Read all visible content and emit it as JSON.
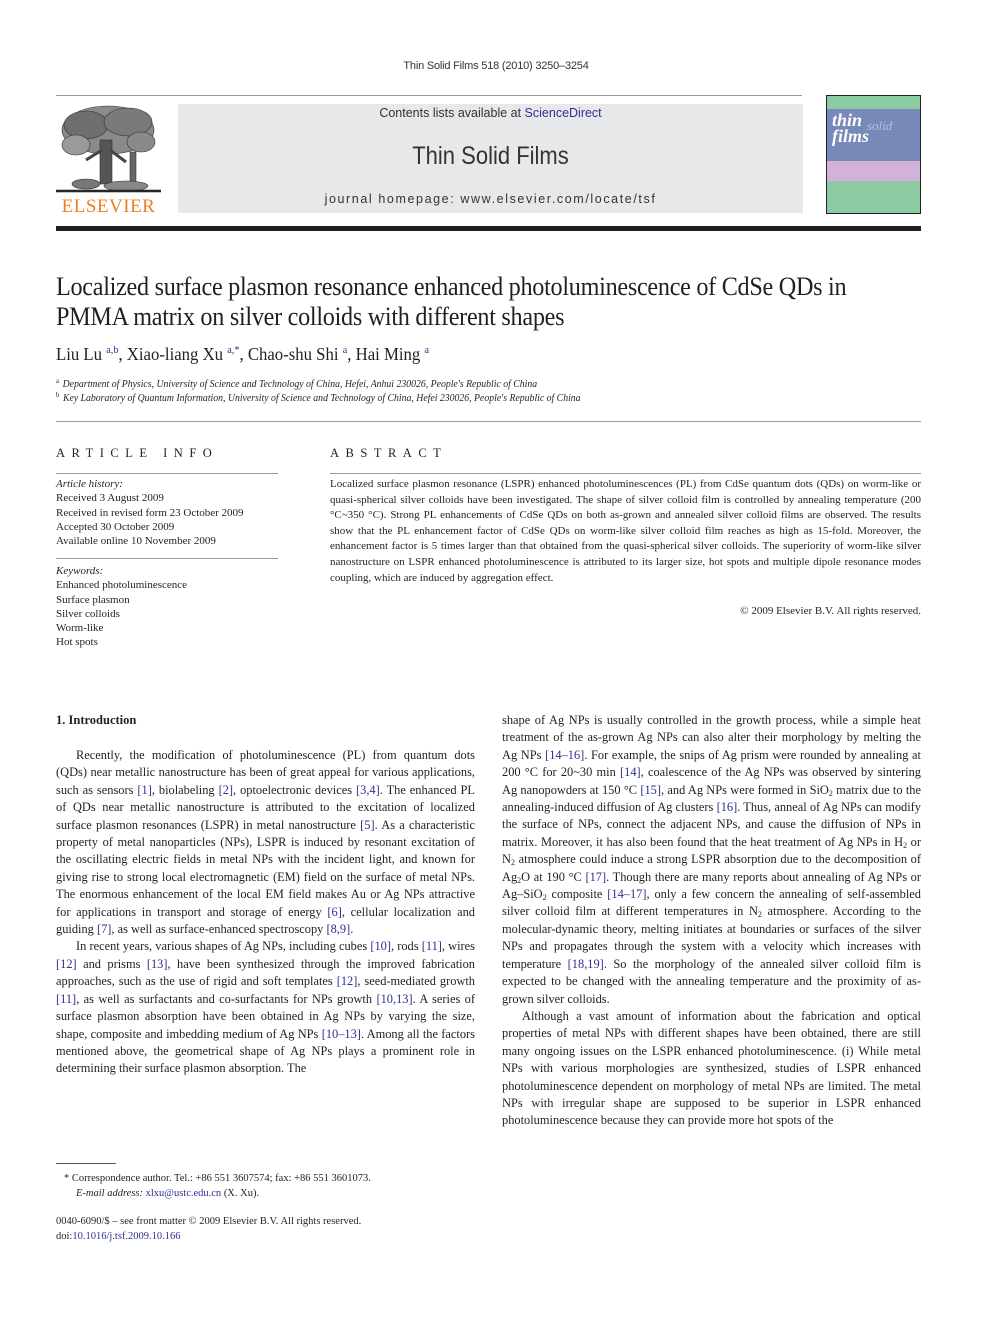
{
  "header": {
    "running_head": "Thin Solid Films 518 (2010) 3250–3254",
    "publisher_logo": "ELSEVIER",
    "contents_prefix": "Contents lists available at ",
    "contents_link": "ScienceDirect",
    "journal_title": "Thin Solid Films",
    "homepage": "journal homepage: www.elsevier.com/locate/tsf",
    "cover_word_1": "thin",
    "cover_word_2": "films",
    "cover_word_3": "solid"
  },
  "article": {
    "title": "Localized surface plasmon resonance enhanced photoluminescence of CdSe QDs in PMMA matrix on silver colloids with different shapes",
    "authors": [
      {
        "name": "Liu Lu",
        "sup": "a,b",
        "sep": ", "
      },
      {
        "name": "Xiao-liang Xu",
        "sup": "a,*",
        "sep": ", "
      },
      {
        "name": "Chao-shu Shi",
        "sup": "a",
        "sep": ", "
      },
      {
        "name": "Hai Ming",
        "sup": "a",
        "sep": ""
      }
    ],
    "affiliations": [
      {
        "mark": "a",
        "text": "Department of Physics, University of Science and Technology of China, Hefei, Anhui 230026, People's Republic of China"
      },
      {
        "mark": "b",
        "text": "Key Laboratory of Quantum Information, University of Science and Technology of China, Hefei 230026, People's Republic of China"
      }
    ]
  },
  "article_info": {
    "label": "ARTICLE INFO",
    "history_heading": "Article history:",
    "history": [
      "Received 3 August 2009",
      "Received in revised form 23 October 2009",
      "Accepted 30 October 2009",
      "Available online 10 November 2009"
    ],
    "keywords_heading": "Keywords:",
    "keywords": [
      "Enhanced photoluminescence",
      "Surface plasmon",
      "Silver colloids",
      "Worm-like",
      "Hot spots"
    ]
  },
  "abstract": {
    "label": "ABSTRACT",
    "text": "Localized surface plasmon resonance (LSPR) enhanced photoluminescences (PL) from CdSe quantum dots (QDs) on worm-like or quasi-spherical silver colloids have been investigated. The shape of silver colloid film is controlled by annealing temperature (200 °C~350 °C). Strong PL enhancements of CdSe QDs on both as-grown and annealed silver colloid films are observed. The results show that the PL enhancement factor of CdSe QDs on worm-like silver colloid film reaches as high as 15-fold. Moreover, the enhancement factor is 5 times larger than that obtained from the quasi-spherical silver colloids. The superiority of worm-like silver nanostructure on LSPR enhanced photoluminescence is attributed to its larger size, hot spots and multiple dipole resonance modes coupling, which are induced by aggregation effect.",
    "copyright": "© 2009 Elsevier B.V. All rights reserved."
  },
  "body": {
    "section_heading": "1. Introduction",
    "left_paragraphs": [
      [
        {
          "t": "Recently, the modification of photoluminescence (PL) from quantum dots (QDs) near metallic nanostructure has been of great appeal for various applications, such as sensors "
        },
        {
          "ref": "[1]"
        },
        {
          "t": ", biolabeling "
        },
        {
          "ref": "[2]"
        },
        {
          "t": ", optoelectronic devices "
        },
        {
          "ref": "[3,4]"
        },
        {
          "t": ". The enhanced PL of QDs near metallic nanostructure is attributed to the excitation of localized surface plasmon resonances (LSPR) in metal nanostructure "
        },
        {
          "ref": "[5]"
        },
        {
          "t": ". As a characteristic property of metal nanoparticles (NPs), LSPR is induced by resonant excitation of the oscillating electric fields in metal NPs with the incident light, and known for giving rise to strong local electromagnetic (EM) field on the surface of metal NPs. The enormous enhancement of the local EM field makes Au or Ag NPs attractive for applications in transport and storage of energy "
        },
        {
          "ref": "[6]"
        },
        {
          "t": ", cellular localization and guiding "
        },
        {
          "ref": "[7]"
        },
        {
          "t": ", as well as surface-enhanced spectroscopy "
        },
        {
          "ref": "[8,9]"
        },
        {
          "t": "."
        }
      ],
      [
        {
          "t": "In recent years, various shapes of Ag NPs, including cubes "
        },
        {
          "ref": "[10]"
        },
        {
          "t": ", rods "
        },
        {
          "ref": "[11]"
        },
        {
          "t": ", wires "
        },
        {
          "ref": "[12]"
        },
        {
          "t": " and prisms "
        },
        {
          "ref": "[13]"
        },
        {
          "t": ", have been synthesized through the improved fabrication approaches, such as the use of rigid and soft templates "
        },
        {
          "ref": "[12]"
        },
        {
          "t": ", seed-mediated growth "
        },
        {
          "ref": "[11]"
        },
        {
          "t": ", as well as surfactants and co-surfactants for NPs growth "
        },
        {
          "ref": "[10,13]"
        },
        {
          "t": ". A series of surface plasmon absorption have been obtained in Ag NPs by varying the size, shape, composite and imbedding medium of Ag NPs "
        },
        {
          "ref": "[10–13]"
        },
        {
          "t": ". Among all the factors mentioned above, the geometrical shape of Ag NPs plays a prominent role in determining their surface plasmon absorption. The"
        }
      ]
    ],
    "right_paragraphs": [
      [
        {
          "t": "shape of Ag NPs is usually controlled in the growth process, while a simple heat treatment of the as-grown Ag NPs can also alter their morphology by melting the Ag NPs "
        },
        {
          "ref": "[14–16]"
        },
        {
          "t": ". For example, the snips of Ag prism were rounded by annealing at 200 °C for 20~30 min "
        },
        {
          "ref": "[14]"
        },
        {
          "t": ", coalescence of the Ag NPs was observed by sintering Ag nanopowders at 150 °C "
        },
        {
          "ref": "[15]"
        },
        {
          "t": ", and Ag NPs were formed in SiO"
        },
        {
          "sub": "2"
        },
        {
          "t": " matrix due to the annealing-induced diffusion of Ag clusters "
        },
        {
          "ref": "[16]"
        },
        {
          "t": ". Thus, anneal of Ag NPs can modify the surface of NPs, connect the adjacent NPs, and cause the diffusion of NPs in matrix. Moreover, it has also been found that the heat treatment of Ag NPs in H"
        },
        {
          "sub": "2"
        },
        {
          "t": " or N"
        },
        {
          "sub": "2"
        },
        {
          "t": " atmosphere could induce a strong LSPR absorption due to the decomposition of Ag"
        },
        {
          "sub": "2"
        },
        {
          "t": "O at 190 °C "
        },
        {
          "ref": "[17]"
        },
        {
          "t": ". Though there are many reports about annealing of Ag NPs or Ag–SiO"
        },
        {
          "sub": "2"
        },
        {
          "t": " composite "
        },
        {
          "ref": "[14–17]"
        },
        {
          "t": ", only a few concern the annealing of self-assembled silver colloid film at different temperatures in N"
        },
        {
          "sub": "2"
        },
        {
          "t": " atmosphere. According to the molecular-dynamic theory, melting initiates at boundaries or surfaces of the silver NPs and propagates through the system with a velocity which increases with temperature "
        },
        {
          "ref": "[18,19]"
        },
        {
          "t": ". So the morphology of the annealed silver colloid film is expected to be changed with the annealing temperature and the proximity of as-grown silver colloids."
        }
      ],
      [
        {
          "t": "Although a vast amount of information about the fabrication and optical properties of metal NPs with different shapes have been obtained, there are still many ongoing issues on the LSPR enhanced photoluminescence. (i) While metal NPs with various morphologies are synthesized, studies of LSPR enhanced photoluminescence dependent on morphology of metal NPs are limited. The metal NPs with irregular shape are supposed to be superior in LSPR enhanced photoluminescence because they can provide more hot spots of the"
        }
      ]
    ]
  },
  "footnotes": {
    "correspondence": "* Correspondence author. Tel.: +86 551 3607574; fax: +86 551 3601073.",
    "email_label": "E-mail address: ",
    "email": "xlxu@ustc.edu.cn",
    "email_suffix": " (X. Xu).",
    "front_matter": "0040-6090/$ – see front matter © 2009 Elsevier B.V. All rights reserved.",
    "doi_prefix": "doi:",
    "doi": "10.1016/j.tsf.2009.10.166"
  },
  "colors": {
    "link": "#2e3192",
    "elsevier_orange": "#f07f1f",
    "banner_gray": "#e7e8ea"
  }
}
